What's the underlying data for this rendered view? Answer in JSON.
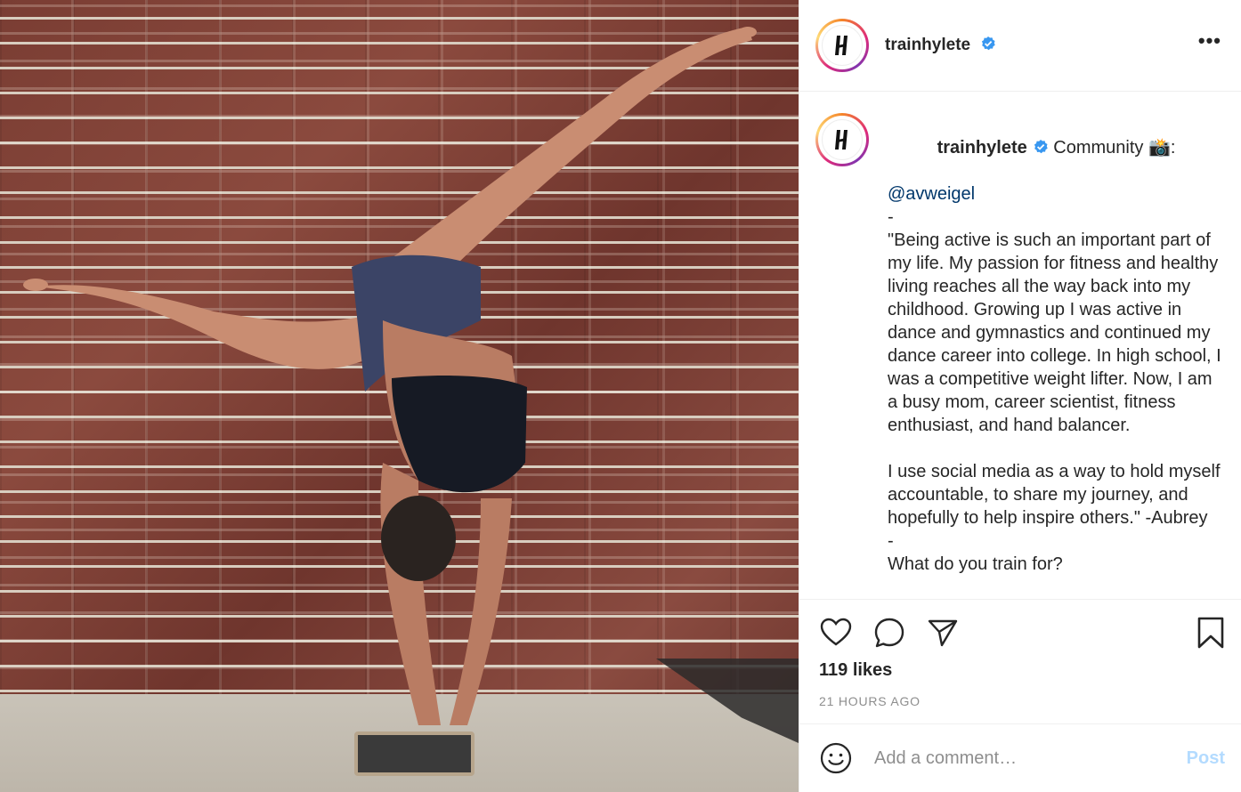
{
  "post": {
    "username": "trainhylete",
    "verified_icon": "verified-badge-icon",
    "more_label": "•••",
    "caption": {
      "username": "trainhylete",
      "title": " Community 📸:",
      "mention": "@avweigel",
      "dash1": "-",
      "quote": "\"Being active is such an important part of my life. My passion for fitness and healthy living reaches all the way back into my childhood. Growing up I was active in dance and gymnastics and continued my dance career into college. In high school, I was a competitive weight lifter. Now, I am a busy mom, career scientist, fitness enthusiast, and hand balancer.",
      "paragraph2": "I use social media as a way to hold myself accountable, to share my journey, and hopefully to help inspire others.\" -Aubrey",
      "dash2": "-",
      "question": "What do you train for?"
    },
    "likes": "119 likes",
    "time_ago": "21 HOURS AGO",
    "comment": {
      "placeholder": "Add a comment…",
      "post_label": "Post"
    }
  },
  "colors": {
    "verified": "#3897f0",
    "link": "#00376b",
    "muted": "#8e8e8e",
    "post_disabled": "#b3dbff"
  }
}
